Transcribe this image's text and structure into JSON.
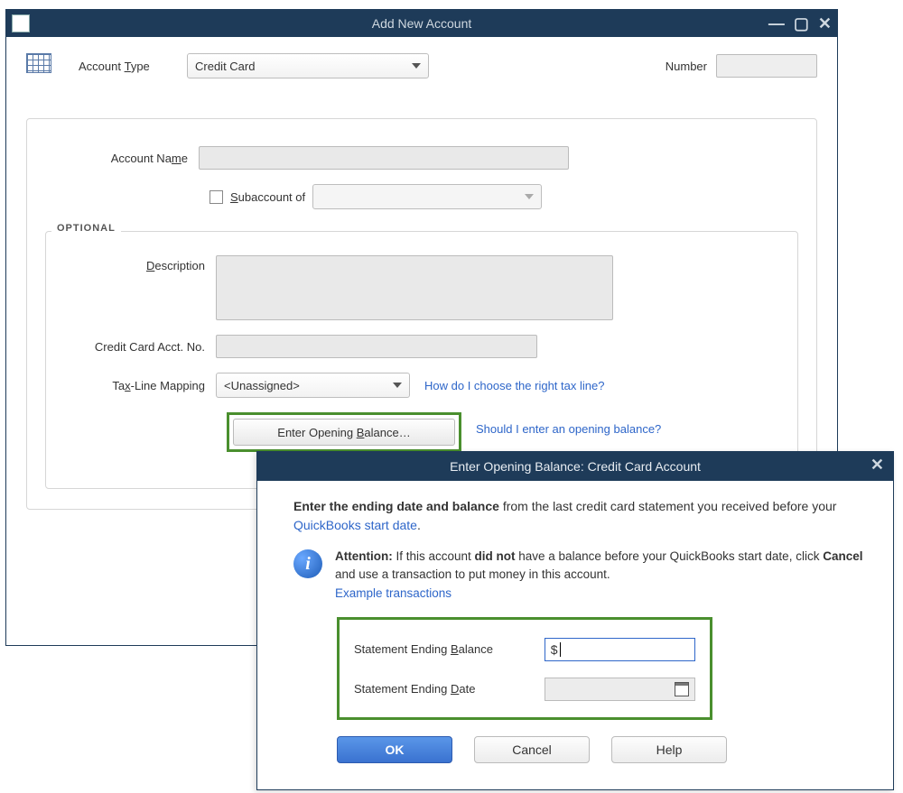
{
  "window1": {
    "title": "Add New Account",
    "account_type_label": "Account Type",
    "account_type_value": "Credit Card",
    "number_label": "Number",
    "account_name_label": "Account Name",
    "subaccount_label": "Subaccount of",
    "optional_label": "OPTIONAL",
    "description_label": "Description",
    "cc_acct_label": "Credit Card Acct. No.",
    "tax_mapping_label": "Tax-Line Mapping",
    "tax_mapping_value": "<Unassigned>",
    "tax_link": "How do I choose the right tax line?",
    "open_balance_button": "Enter Opening Balance…",
    "open_balance_link": "Should I enter an opening balance?"
  },
  "window2": {
    "title": "Enter Opening Balance: Credit Card Account",
    "intro_bold": "Enter the ending date and balance",
    "intro_rest": " from the last credit card statement you received before your ",
    "intro_link": "QuickBooks start date",
    "attention_label": "Attention:",
    "attention_p1": " If this account ",
    "attention_b1": "did not",
    "attention_p2": " have a balance before your QuickBooks start date, click ",
    "attention_b2": "Cancel",
    "attention_p3": " and use a transaction to put money in this account.",
    "example_link": "Example transactions",
    "balance_label": "Statement Ending Balance",
    "balance_value": "$",
    "date_label": "Statement Ending Date",
    "ok": "OK",
    "cancel": "Cancel",
    "help": "Help"
  }
}
